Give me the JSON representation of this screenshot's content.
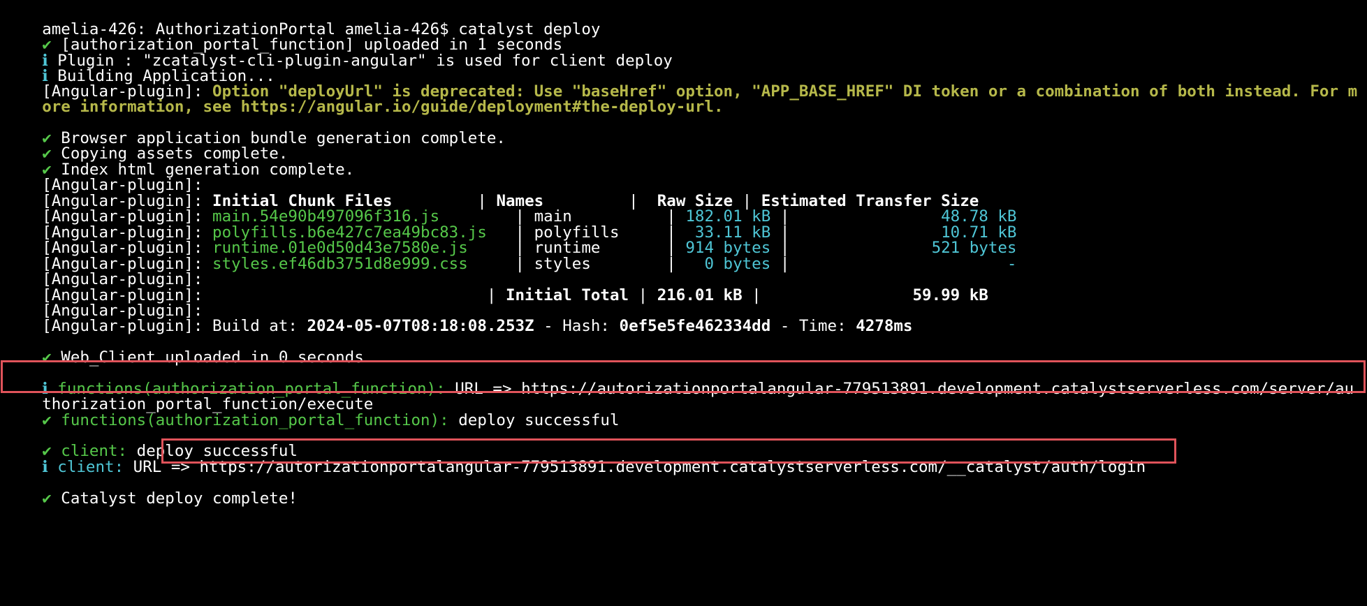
{
  "terminal": {
    "colors": {
      "background": "#000000",
      "text": "#ffffff",
      "success": "#56c84a",
      "info": "#4fc6d6",
      "warning": "#b6b84a",
      "highlight_border": "#e0535a"
    },
    "lines": {
      "l01": {
        "prompt": "amelia-426: AuthorizationPortal amelia-426$ catalyst deploy"
      },
      "l02": {
        "icon": "✔",
        "text": " [authorization_portal_function] uploaded in 1 seconds"
      },
      "l03": {
        "icon": "ℹ",
        "text": " Plugin : \"zcatalyst-cli-plugin-angular\" is used for client deploy"
      },
      "l04": {
        "icon": "ℹ",
        "text": " Building Application..."
      },
      "l05": {
        "prefix": "[Angular-plugin]: ",
        "warning": "Option \"deployUrl\" is deprecated: Use \"baseHref\" option, \"APP_BASE_HREF\" DI token or a combination of both instead. For m"
      },
      "l06": {
        "warning": "ore information, see https://angular.io/guide/deployment#the-deploy-url."
      },
      "l07": {
        "icon": "✔",
        "text": " Browser application bundle generation complete."
      },
      "l08": {
        "icon": "✔",
        "text": " Copying assets complete."
      },
      "l09": {
        "icon": "✔",
        "text": " Index html generation complete."
      },
      "l10": {
        "prefix": "[Angular-plugin]:"
      },
      "l11": {
        "prefix": "[Angular-plugin]: ",
        "c1": "Initial Chunk Files",
        "sep1": "         | ",
        "c2": "Names",
        "sep2": "         |  ",
        "c3": "Raw Size",
        "sep3": " | ",
        "c4": "Estimated Transfer Size"
      },
      "l12": {
        "prefix": "[Angular-plugin]: ",
        "file": "main.54e90b497096f316.js",
        "pad1": "        | ",
        "name": "main",
        "pad2": "          | ",
        "raw": "182.01 kB",
        "pad3": " | ",
        "est": "               48.78 kB"
      },
      "l13": {
        "prefix": "[Angular-plugin]: ",
        "file": "polyfills.b6e427c7ea49bc83.js",
        "pad1": "   | ",
        "name": "polyfills",
        "pad2": "     |  ",
        "raw": "33.11 kB",
        "pad3": " | ",
        "est": "               10.71 kB"
      },
      "l14": {
        "prefix": "[Angular-plugin]: ",
        "file": "runtime.01e0d50d43e7580e.js",
        "pad1": "     | ",
        "name": "runtime",
        "pad2": "       | ",
        "raw": "914 bytes",
        "pad3": " | ",
        "est": "              521 bytes"
      },
      "l15": {
        "prefix": "[Angular-plugin]: ",
        "file": "styles.ef46db3751d8e999.css",
        "pad1": "     | ",
        "name": "styles",
        "pad2": "        |   ",
        "raw": "0 bytes",
        "pad3": " | ",
        "est": "                      -"
      },
      "l16": {
        "prefix": "[Angular-plugin]:"
      },
      "l17": {
        "prefix": "[Angular-plugin]: ",
        "pad1": "                             | ",
        "total_label": "Initial Total",
        "pad2": " | ",
        "total_raw": "216.01 kB",
        "pad3": " | ",
        "total_est": "               59.99 kB"
      },
      "l18": {
        "prefix": "[Angular-plugin]:"
      },
      "l19": {
        "prefix": "[Angular-plugin]: ",
        "build_label": "Build at: ",
        "build_at": "2024-05-07T08:18:08.253Z",
        "hash_label": " - Hash: ",
        "hash": "0ef5e5fe462334dd",
        "time_label": " - Time: ",
        "time": "4278ms"
      },
      "l20": {
        "icon": "✔",
        "text": " Web_Client uploaded in 0 seconds"
      },
      "l21": {
        "icon": "ℹ",
        "label": " functions(authorization_portal_function):",
        "text": " URL => https://autorizationportalangular-779513891.development.catalystserverless.com/server/au"
      },
      "l22": {
        "text": "thorization_portal_function/execute"
      },
      "l23": {
        "icon": "✔",
        "label": " functions(authorization_portal_function):",
        "text": " deploy successful"
      },
      "l24": {
        "icon": "✔",
        "label": " client:",
        "text": " deploy successful"
      },
      "l25": {
        "icon": "ℹ",
        "label": " client:",
        "text": " URL => ",
        "url": "https://autorizationportalangular-779513891.development.catalystserverless.com/__catalyst/auth/login"
      },
      "l26": {
        "icon": "✔",
        "text": " Catalyst deploy complete!"
      }
    }
  }
}
